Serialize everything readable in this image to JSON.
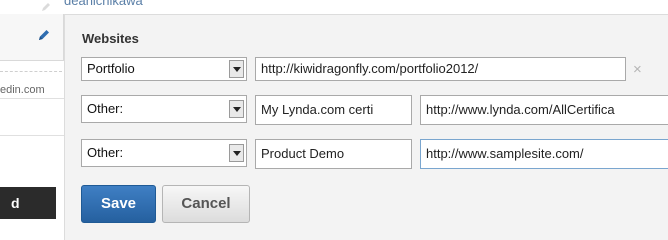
{
  "top": {
    "username": "deanichikawa"
  },
  "left": {
    "linkedin_text": "edin.com",
    "dark_button_label": "d"
  },
  "websites": {
    "heading": "Websites",
    "rows": [
      {
        "type": "Portfolio",
        "url": "http://kiwidragonfly.com/portfolio2012/",
        "remove": "×"
      },
      {
        "type": "Other:",
        "name": "My Lynda.com certi",
        "url": "http://www.lynda.com/AllCertifica"
      },
      {
        "type": "Other:",
        "name": "Product Demo",
        "url": "http://www.samplesite.com/"
      }
    ]
  },
  "actions": {
    "save_label": "Save",
    "cancel_label": "Cancel"
  },
  "colors": {
    "accent": "#2f6db0",
    "panel_bg": "#f3f3f3",
    "focus_border": "#7aa6cf"
  },
  "icons": {
    "edit": "pencil-icon",
    "dropdown": "dropdown-arrow-icon",
    "remove": "close-icon"
  }
}
